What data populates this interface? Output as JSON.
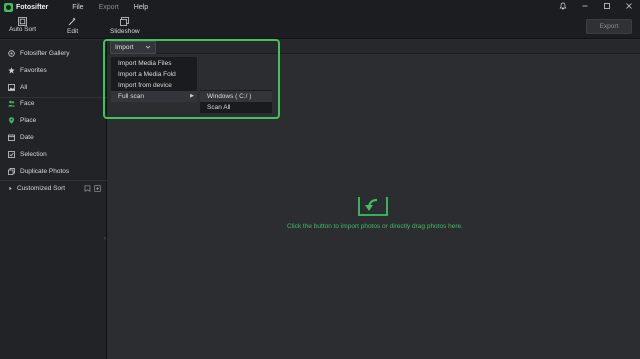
{
  "app": {
    "name": "Fotosifter",
    "brand_color": "#3fbf5f",
    "icon": "fotosifter-logo-icon"
  },
  "menubar": [
    {
      "label": "File",
      "enabled": true
    },
    {
      "label": "Export",
      "enabled": false
    },
    {
      "label": "Help",
      "enabled": true
    }
  ],
  "window_controls": {
    "icons": [
      "bell-icon",
      "minimize-icon",
      "maximize-icon",
      "close-icon"
    ]
  },
  "toolbar": {
    "tools": [
      {
        "label": "Auto Sort",
        "icon": "auto-sort-icon"
      },
      {
        "label": "Edit",
        "icon": "edit-wand-icon"
      },
      {
        "label": "Slideshow",
        "icon": "slideshow-icon"
      }
    ],
    "export_label": "Export",
    "export_enabled": false
  },
  "sidebar": {
    "items": [
      {
        "label": "Fotosifter Gallery",
        "icon": "gallery-icon"
      },
      {
        "label": "Favorites",
        "icon": "star-icon"
      },
      {
        "label": "All",
        "icon": "all-photos-icon"
      },
      {
        "label": "Face",
        "icon": "people-icon"
      },
      {
        "label": "Place",
        "icon": "location-pin-icon"
      },
      {
        "label": "Date",
        "icon": "calendar-icon"
      },
      {
        "label": "Selection",
        "icon": "selection-icon"
      },
      {
        "label": "Duplicate Photos",
        "icon": "duplicate-icon"
      },
      {
        "label": "Customized Sort",
        "icon": "caret-right-icon"
      }
    ]
  },
  "import_menu": {
    "button_label": "Import",
    "items": [
      "Import Media Files",
      "Import a Media Fold",
      "Import from device",
      "Full scan"
    ],
    "submenu": [
      "Windows ( C:/ )",
      "Scan All"
    ]
  },
  "empty_state": {
    "hint": "Click the button to import photos or directly drag photos here.",
    "icon": "import-arrow-icon"
  }
}
